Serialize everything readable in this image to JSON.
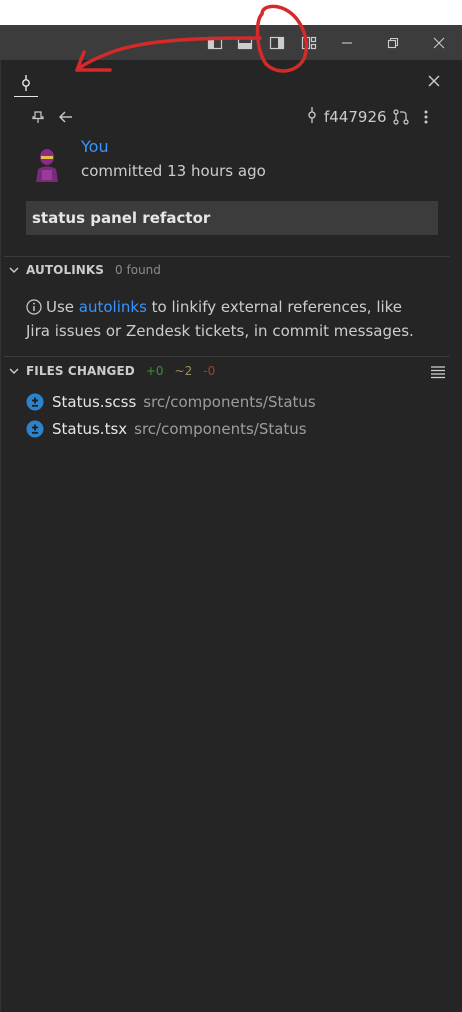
{
  "titlebar": {
    "buttons": [
      {
        "name": "toggle-primary-sidebar-icon"
      },
      {
        "name": "toggle-panel-icon"
      },
      {
        "name": "toggle-secondary-sidebar-icon"
      },
      {
        "name": "customize-layout-icon"
      },
      {
        "name": "minimize-icon"
      },
      {
        "name": "restore-icon"
      },
      {
        "name": "close-window-icon"
      }
    ]
  },
  "panel": {
    "tab_icon": "git-commit-icon",
    "close_icon": "close-icon"
  },
  "commit": {
    "sha": "f447926",
    "author": "You",
    "committed_label": "committed 13 hours ago",
    "message": "status panel refactor"
  },
  "autolinks": {
    "title": "AUTOLINKS",
    "count_label": "0 found",
    "info_prefix": "Use ",
    "info_link": "autolinks",
    "info_suffix": " to linkify external references, like Jira issues or Zendesk tickets, in commit messages."
  },
  "files_changed": {
    "title": "FILES CHANGED",
    "added": "+0",
    "modified": "~2",
    "deleted": "-0",
    "files": [
      {
        "name": "Status.scss",
        "path": "src/components/Status"
      },
      {
        "name": "Status.tsx",
        "path": "src/components/Status"
      }
    ]
  },
  "colors": {
    "background": "#252526",
    "titlebar": "#3c3c3c",
    "link": "#3794ff",
    "added": "#3d8f3d",
    "modified": "#9a8f5e",
    "deleted": "#a5412b",
    "annotation": "#d42a2a"
  }
}
